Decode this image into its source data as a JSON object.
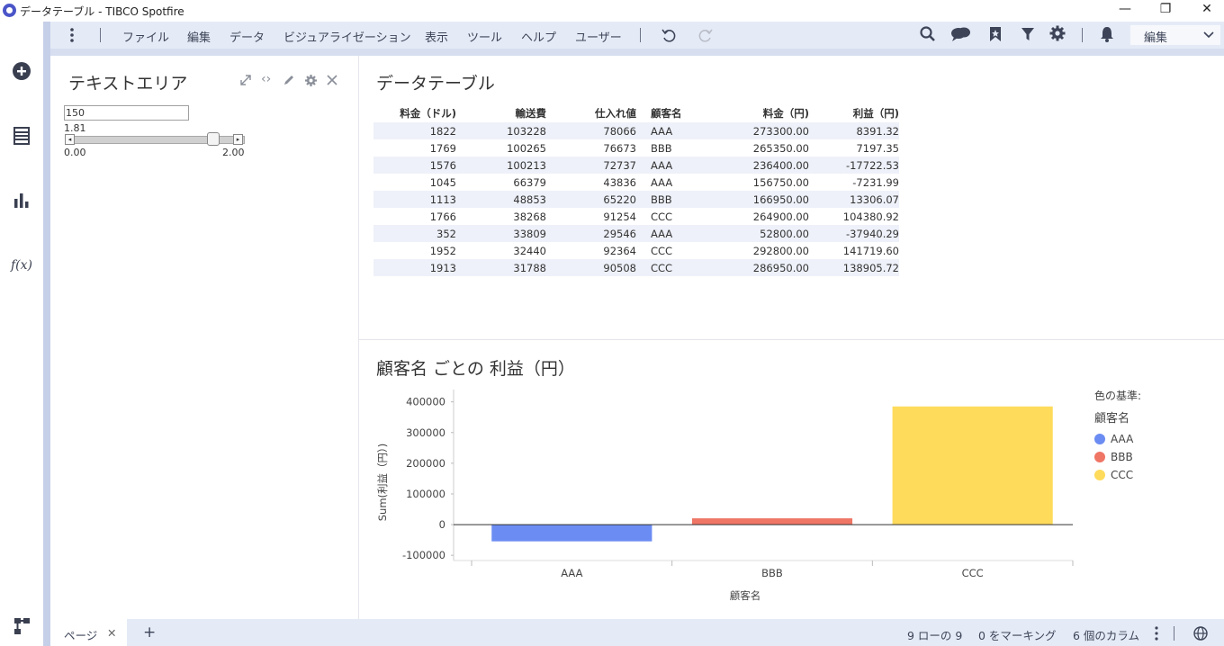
{
  "window": {
    "title": "データテーブル - TIBCO Spotfire",
    "minimize": "—",
    "restore": "❐",
    "close": "✕"
  },
  "menu": {
    "items": [
      "ファイル",
      "編集",
      "データ",
      "ビジュアライゼーション",
      "表示",
      "ツール",
      "ヘルプ",
      "ユーザー"
    ],
    "edit_mode": "編集"
  },
  "text_area": {
    "title": "テキストエリア",
    "input_value": "150",
    "slider_value": "1.81",
    "slider_min": "0.00",
    "slider_max": "2.00",
    "slider_fraction": 0.905
  },
  "data_table": {
    "title": "データテーブル",
    "columns": [
      "料金（ドル)",
      "輸送費",
      "仕入れ値",
      "顧客名",
      "料金（円)",
      "利益（円)"
    ],
    "rows": [
      [
        "1822",
        "103228",
        "78066",
        "AAA",
        "273300.00",
        "8391.32"
      ],
      [
        "1769",
        "100265",
        "76673",
        "BBB",
        "265350.00",
        "7197.35"
      ],
      [
        "1576",
        "100213",
        "72737",
        "AAA",
        "236400.00",
        "-17722.53"
      ],
      [
        "1045",
        "66379",
        "43836",
        "AAA",
        "156750.00",
        "-7231.99"
      ],
      [
        "1113",
        "48853",
        "65220",
        "BBB",
        "166950.00",
        "13306.07"
      ],
      [
        "1766",
        "38268",
        "91254",
        "CCC",
        "264900.00",
        "104380.92"
      ],
      [
        "352",
        "33809",
        "29546",
        "AAA",
        "52800.00",
        "-37940.29"
      ],
      [
        "1952",
        "32440",
        "92364",
        "CCC",
        "292800.00",
        "141719.60"
      ],
      [
        "1913",
        "31788",
        "90508",
        "CCC",
        "286950.00",
        "138905.72"
      ]
    ]
  },
  "chart_data": {
    "type": "bar",
    "title": "顧客名 ごとの 利益（円）",
    "categories": [
      "AAA",
      "BBB",
      "CCC"
    ],
    "values": [
      -54503.49,
      20503.42,
      385006.24
    ],
    "colors": [
      "#6b8cf2",
      "#ef7565",
      "#fedb5b"
    ],
    "xlabel": "顧客名",
    "ylabel": "Sum(利益（円）)",
    "ylim": [
      -100000,
      400000
    ],
    "yticks": [
      -100000,
      0,
      100000,
      200000,
      300000,
      400000
    ],
    "legend": {
      "title": "色の基準:",
      "subtitle": "顧客名",
      "position": "right"
    }
  },
  "footer": {
    "page_tab": "ページ",
    "page_close": "✕",
    "add_page": "+",
    "rows_status": "9 ローの 9",
    "marking_status": "0 をマーキング",
    "columns_status": "6 個のカラム"
  }
}
